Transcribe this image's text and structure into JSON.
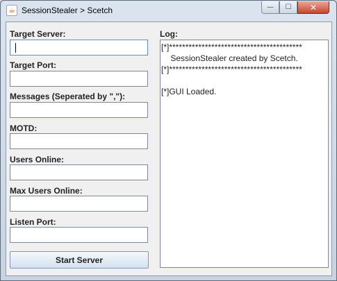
{
  "window": {
    "title": "SessionStealer > Scetch",
    "icon": "java-icon",
    "controls": {
      "minimize": "—",
      "maximize": "☐",
      "close": "✕"
    }
  },
  "form": {
    "fields": [
      {
        "label": "Target Server:",
        "value": ""
      },
      {
        "label": "Target Port:",
        "value": ""
      },
      {
        "label": "Messages (Seperated by \",\"):",
        "value": ""
      },
      {
        "label": "MOTD:",
        "value": ""
      },
      {
        "label": "Users Online:",
        "value": ""
      },
      {
        "label": "Max Users Online:",
        "value": ""
      },
      {
        "label": "Listen Port:",
        "value": ""
      }
    ],
    "start_button": "Start Server"
  },
  "log": {
    "label": "Log:",
    "lines": [
      "[*]*****************************************",
      "    SessionStealer created by Scetch.",
      "[*]*****************************************",
      "",
      "[*]GUI Loaded."
    ]
  }
}
